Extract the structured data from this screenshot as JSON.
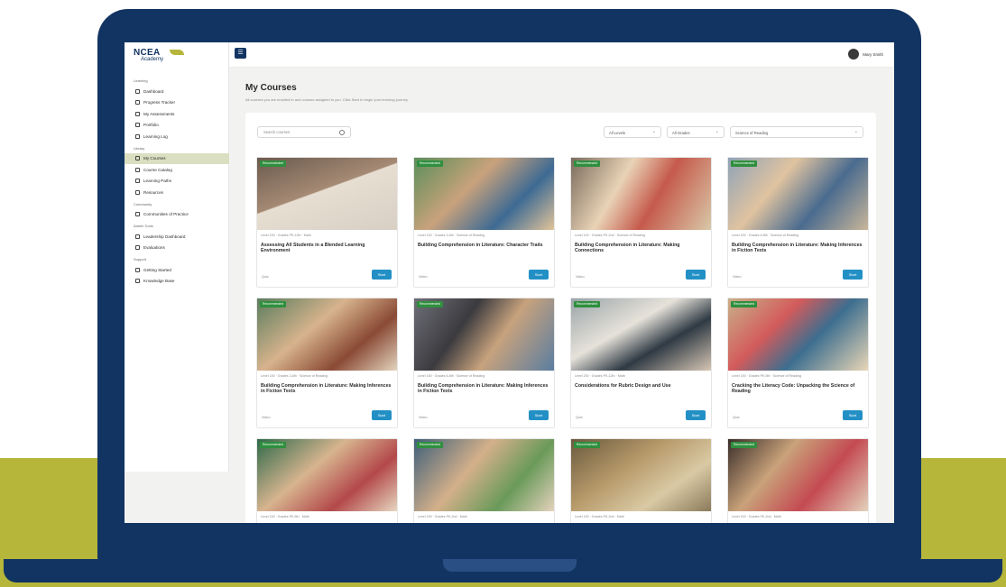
{
  "brand": {
    "logo_main": "NCEA",
    "logo_sub": "Academy"
  },
  "header": {
    "user_name": "Mary Smith"
  },
  "sidebar": {
    "sections": [
      {
        "label": "Learning",
        "items": [
          "Dashboard",
          "Progress Tracker",
          "My Assessments",
          "Portfolio",
          "Learning Log"
        ]
      },
      {
        "label": "Library",
        "items": [
          "My Courses",
          "Course Catalog",
          "Learning Paths",
          "Resources"
        ]
      },
      {
        "label": "Community",
        "items": [
          "Communities of Practice"
        ]
      },
      {
        "label": "Admin Tools",
        "items": [
          "Leadership Dashboard",
          "Evaluations"
        ]
      },
      {
        "label": "Support",
        "items": [
          "Getting Started",
          "Knowledge Base"
        ]
      }
    ],
    "active_item": "My Courses"
  },
  "main": {
    "title": "My Courses",
    "subtitle": "All courses you are enrolled in and courses assigned to you. Click Start to begin your learning journey.",
    "search_placeholder": "Search courses",
    "filters": [
      "All Levels",
      "All Grades",
      "Science of Reading"
    ]
  },
  "courses": [
    {
      "badge": "Recommended",
      "meta": "Level 100 · Grades PK-12th · Math",
      "title": "Assessing All Students in a Blended Learning Environment",
      "stat": "Quiz",
      "action": "Start"
    },
    {
      "badge": "Recommended",
      "meta": "Level 100 · Grades 3-5th · Science of Reading",
      "title": "Building Comprehension in Literature: Character Traits",
      "stat": "Video",
      "action": "Start"
    },
    {
      "badge": "Recommended",
      "meta": "Level 100 · Grades PK-2nd · Science of Reading",
      "title": "Building Comprehension in Literature: Making Connections",
      "stat": "Video",
      "action": "Start"
    },
    {
      "badge": "Recommended",
      "meta": "Level 100 · Grades 6-8th · Science of Reading",
      "title": "Building Comprehension in Literature: Making Inferences in Fiction Texts",
      "stat": "Video",
      "action": "Start"
    },
    {
      "badge": "Recommended",
      "meta": "Level 100 · Grades 3-5th · Science of Reading",
      "title": "Building Comprehension in Literature: Making Inferences in Fiction Texts",
      "stat": "Video",
      "action": "Start"
    },
    {
      "badge": "Recommended",
      "meta": "Level 100 · Grades 6-8th · Science of Reading",
      "title": "Building Comprehension in Literature: Making Inferences in Fiction Texts",
      "stat": "Video",
      "action": "Start"
    },
    {
      "badge": "Recommended",
      "meta": "Level 200 · Grades PK-12th · Math",
      "title": "Considerations for Rubric Design and Use",
      "stat": "Quiz",
      "action": "Start"
    },
    {
      "badge": "Recommended",
      "meta": "Level 100 · Grades PK-5th · Science of Reading",
      "title": "Cracking the Literacy Code: Unpacking the Science of Reading",
      "stat": "Quiz",
      "action": "Start"
    },
    {
      "badge": "Recommended",
      "meta": "Level 100 · Grades PK-5th · Math",
      "title": "",
      "stat": "",
      "action": ""
    },
    {
      "badge": "Recommended",
      "meta": "Level 100 · Grades PK-2nd · Math",
      "title": "",
      "stat": "",
      "action": ""
    },
    {
      "badge": "Recommended",
      "meta": "Level 100 · Grades PK-2nd · Math",
      "title": "",
      "stat": "",
      "action": ""
    },
    {
      "badge": "Recommended",
      "meta": "Level 100 · Grades PK-2nd · Math",
      "title": "",
      "stat": "",
      "action": ""
    }
  ],
  "colors": {
    "navy": "#123462",
    "olive": "#b5b63a",
    "button": "#2390c5",
    "badge": "#2f8f3e",
    "active_nav": "#d9dfc0"
  }
}
